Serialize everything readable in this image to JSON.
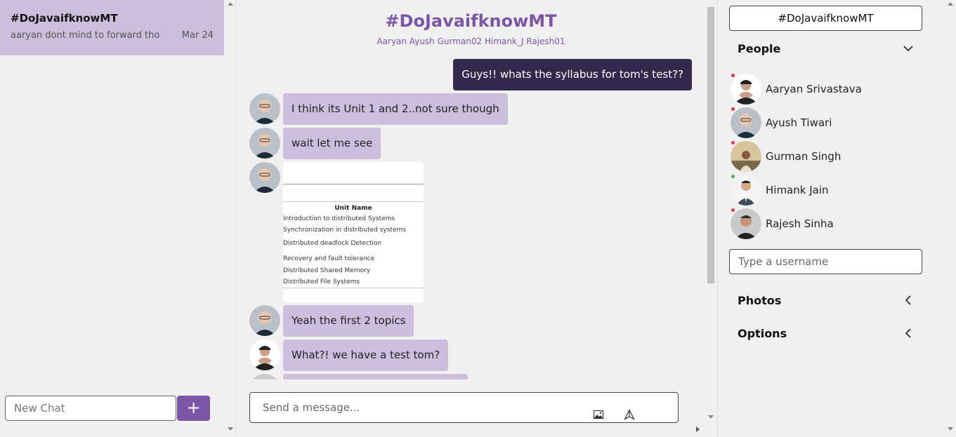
{
  "colors": {
    "accent": "#7b55a8",
    "incoming_bubble": "#cbbfdd",
    "outgoing_bubble": "#33294c",
    "online": "#4caf50",
    "offline": "#e53935"
  },
  "sidebar": {
    "chats": [
      {
        "title": "#DoJavaifknowMT",
        "preview": "aaryan dont mind to forward tho",
        "date": "Mar 24"
      }
    ],
    "new_chat_placeholder": "New Chat",
    "add_label": "+"
  },
  "room": {
    "title": "#DoJavaifknowMT",
    "members": "Aaryan Ayush Gurman02 Himank_J Rajesh01"
  },
  "messages": [
    {
      "direction": "out",
      "text": "Guys!! whats the syllabus for tom's test??"
    },
    {
      "direction": "in",
      "text": "I think its Unit 1 and 2..not sure though"
    },
    {
      "direction": "in",
      "text": "wait let me see"
    },
    {
      "direction": "in",
      "type": "image",
      "image_header": "Unit Name",
      "image_rows": [
        "Introduction to distributed Systems",
        "Synchronization in distributed systems",
        "Distributed deadlock Detection",
        "Recovery and fault tolerance",
        "Distributed Shared Memory",
        "Distributed File Systems"
      ]
    },
    {
      "direction": "in",
      "text": "Yeah the first 2 topics"
    },
    {
      "direction": "in",
      "text": "What?! we have a test tom?"
    }
  ],
  "composer": {
    "placeholder": "Send a message...",
    "image_icon": "image-icon",
    "send_icon": "send-icon"
  },
  "details": {
    "room_name": "#DoJavaifknowMT",
    "people_label": "People",
    "people": [
      {
        "name": "Aaryan Srivastava",
        "status": "offline"
      },
      {
        "name": "Ayush Tiwari",
        "status": "offline"
      },
      {
        "name": "Gurman Singh",
        "status": "offline"
      },
      {
        "name": "Himank Jain",
        "status": "online"
      },
      {
        "name": "Rajesh Sinha",
        "status": "offline"
      }
    ],
    "username_placeholder": "Type a username",
    "photos_label": "Photos",
    "options_label": "Options"
  }
}
